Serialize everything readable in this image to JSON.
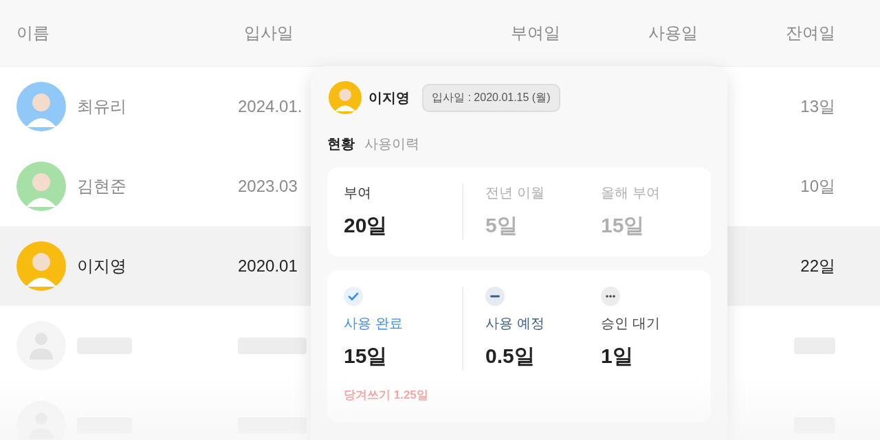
{
  "table": {
    "columns": [
      "이름",
      "입사일",
      "부여일",
      "사용일",
      "잔여일"
    ],
    "rows": [
      {
        "kind": "person",
        "name": "최유리",
        "hire_date": "2024.01.",
        "remaining": "13일",
        "color": "#90c8f8",
        "selected": false
      },
      {
        "kind": "person",
        "name": "김현준",
        "hire_date": "2023.03",
        "remaining": "10일",
        "color": "#a6e0a6",
        "selected": false
      },
      {
        "kind": "person",
        "name": "이지영",
        "hire_date": "2020.01",
        "remaining": "22일",
        "color": "#f8bc10",
        "selected": true
      },
      {
        "kind": "placeholder"
      },
      {
        "kind": "placeholder"
      }
    ]
  },
  "popover": {
    "name": "이지영",
    "badge": "입사일 : 2020.01.15 (월)",
    "tabs": [
      {
        "label": "현황",
        "selected": true
      },
      {
        "label": "사용이력",
        "selected": false
      }
    ],
    "grant": [
      {
        "label": "부여",
        "value": "20일",
        "muted": false
      },
      {
        "label": "전년 이월",
        "value": "5일",
        "muted": true
      },
      {
        "label": "올해 부여",
        "value": "15일",
        "muted": true
      }
    ],
    "usage": [
      {
        "kind": "done",
        "label": "사용 완료",
        "value": "15일"
      },
      {
        "kind": "planned",
        "label": "사용 예정",
        "value": "0.5일"
      },
      {
        "kind": "pending",
        "label": "승인 대기",
        "value": "1일"
      }
    ],
    "note": "당겨쓰기 1.25일"
  }
}
